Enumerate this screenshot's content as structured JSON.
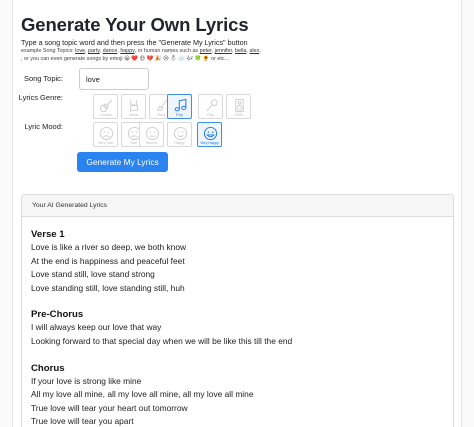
{
  "header": {
    "title": "Generate Your Own Lyrics",
    "instructions": "Type a song topic word and then press the \"Generate My Lyrics\" button",
    "examples_prefix": "example Song Topics:",
    "topic_links": [
      "love",
      "party",
      "dance",
      "happy"
    ],
    "names_prefix": ", or human names such as",
    "name_links": [
      "peter",
      "jennifer",
      "bella",
      "alex"
    ],
    "emoji_prefix": ", or you can even generate songs by emoji",
    "emojis": "😀 ❤️ 😍 💔 🎉 😢 ⛄ 🌧️ 🎶 🍀 🌻",
    "emoji_suffix": "or etc..."
  },
  "form": {
    "topic_label": "Song Topic:",
    "topic_value": "love",
    "genre_label": "Lyrics Genre:",
    "mood_label": "Lyric Mood:",
    "genres": [
      {
        "label": "Country",
        "icon": "guitar-icon",
        "selected": false
      },
      {
        "label": "Metal",
        "icon": "hand-horns-icon",
        "selected": false
      },
      {
        "label": "Rock",
        "icon": "electric-guitar-icon",
        "selected": false
      },
      {
        "label": "Pop",
        "icon": "music-note-icon",
        "selected": true
      },
      {
        "label": "Rap",
        "icon": "microphone-icon",
        "selected": false
      },
      {
        "label": "EDM",
        "icon": "speaker-icon",
        "selected": false
      }
    ],
    "moods": [
      {
        "label": "Very Sad",
        "icon": "very-sad-face-icon",
        "selected": false
      },
      {
        "label": "Sad",
        "icon": "sad-face-icon",
        "selected": false
      },
      {
        "label": "Neutral",
        "icon": "neutral-face-icon",
        "selected": false
      },
      {
        "label": "Happy",
        "icon": "happy-face-icon",
        "selected": false
      },
      {
        "label": "Very Happy",
        "icon": "very-happy-face-icon",
        "selected": true
      }
    ],
    "button_label": "Generate My Lyrics"
  },
  "result": {
    "heading": "Your AI Generated Lyrics",
    "stanzas": [
      {
        "title": "Verse 1",
        "lines": [
          "Love is like a river so deep, we both know",
          "At the end is happiness and peaceful feet",
          "Love stand still, love stand strong",
          "Love standing still, love standing still, huh"
        ]
      },
      {
        "title": "Pre-Chorus",
        "lines": [
          "I will always keep our love that way",
          "Looking forward to that special day when we will be like this till the end"
        ]
      },
      {
        "title": "Chorus",
        "lines": [
          "If your love is strong like mine",
          "All my love all mine, all my love all mine, all my love all mine",
          "True love will tear your heart out tomorrow",
          "True love will tear you apart"
        ]
      }
    ]
  },
  "colors": {
    "accent": "#2b83f0",
    "selected_border": "#3d8fe3"
  }
}
